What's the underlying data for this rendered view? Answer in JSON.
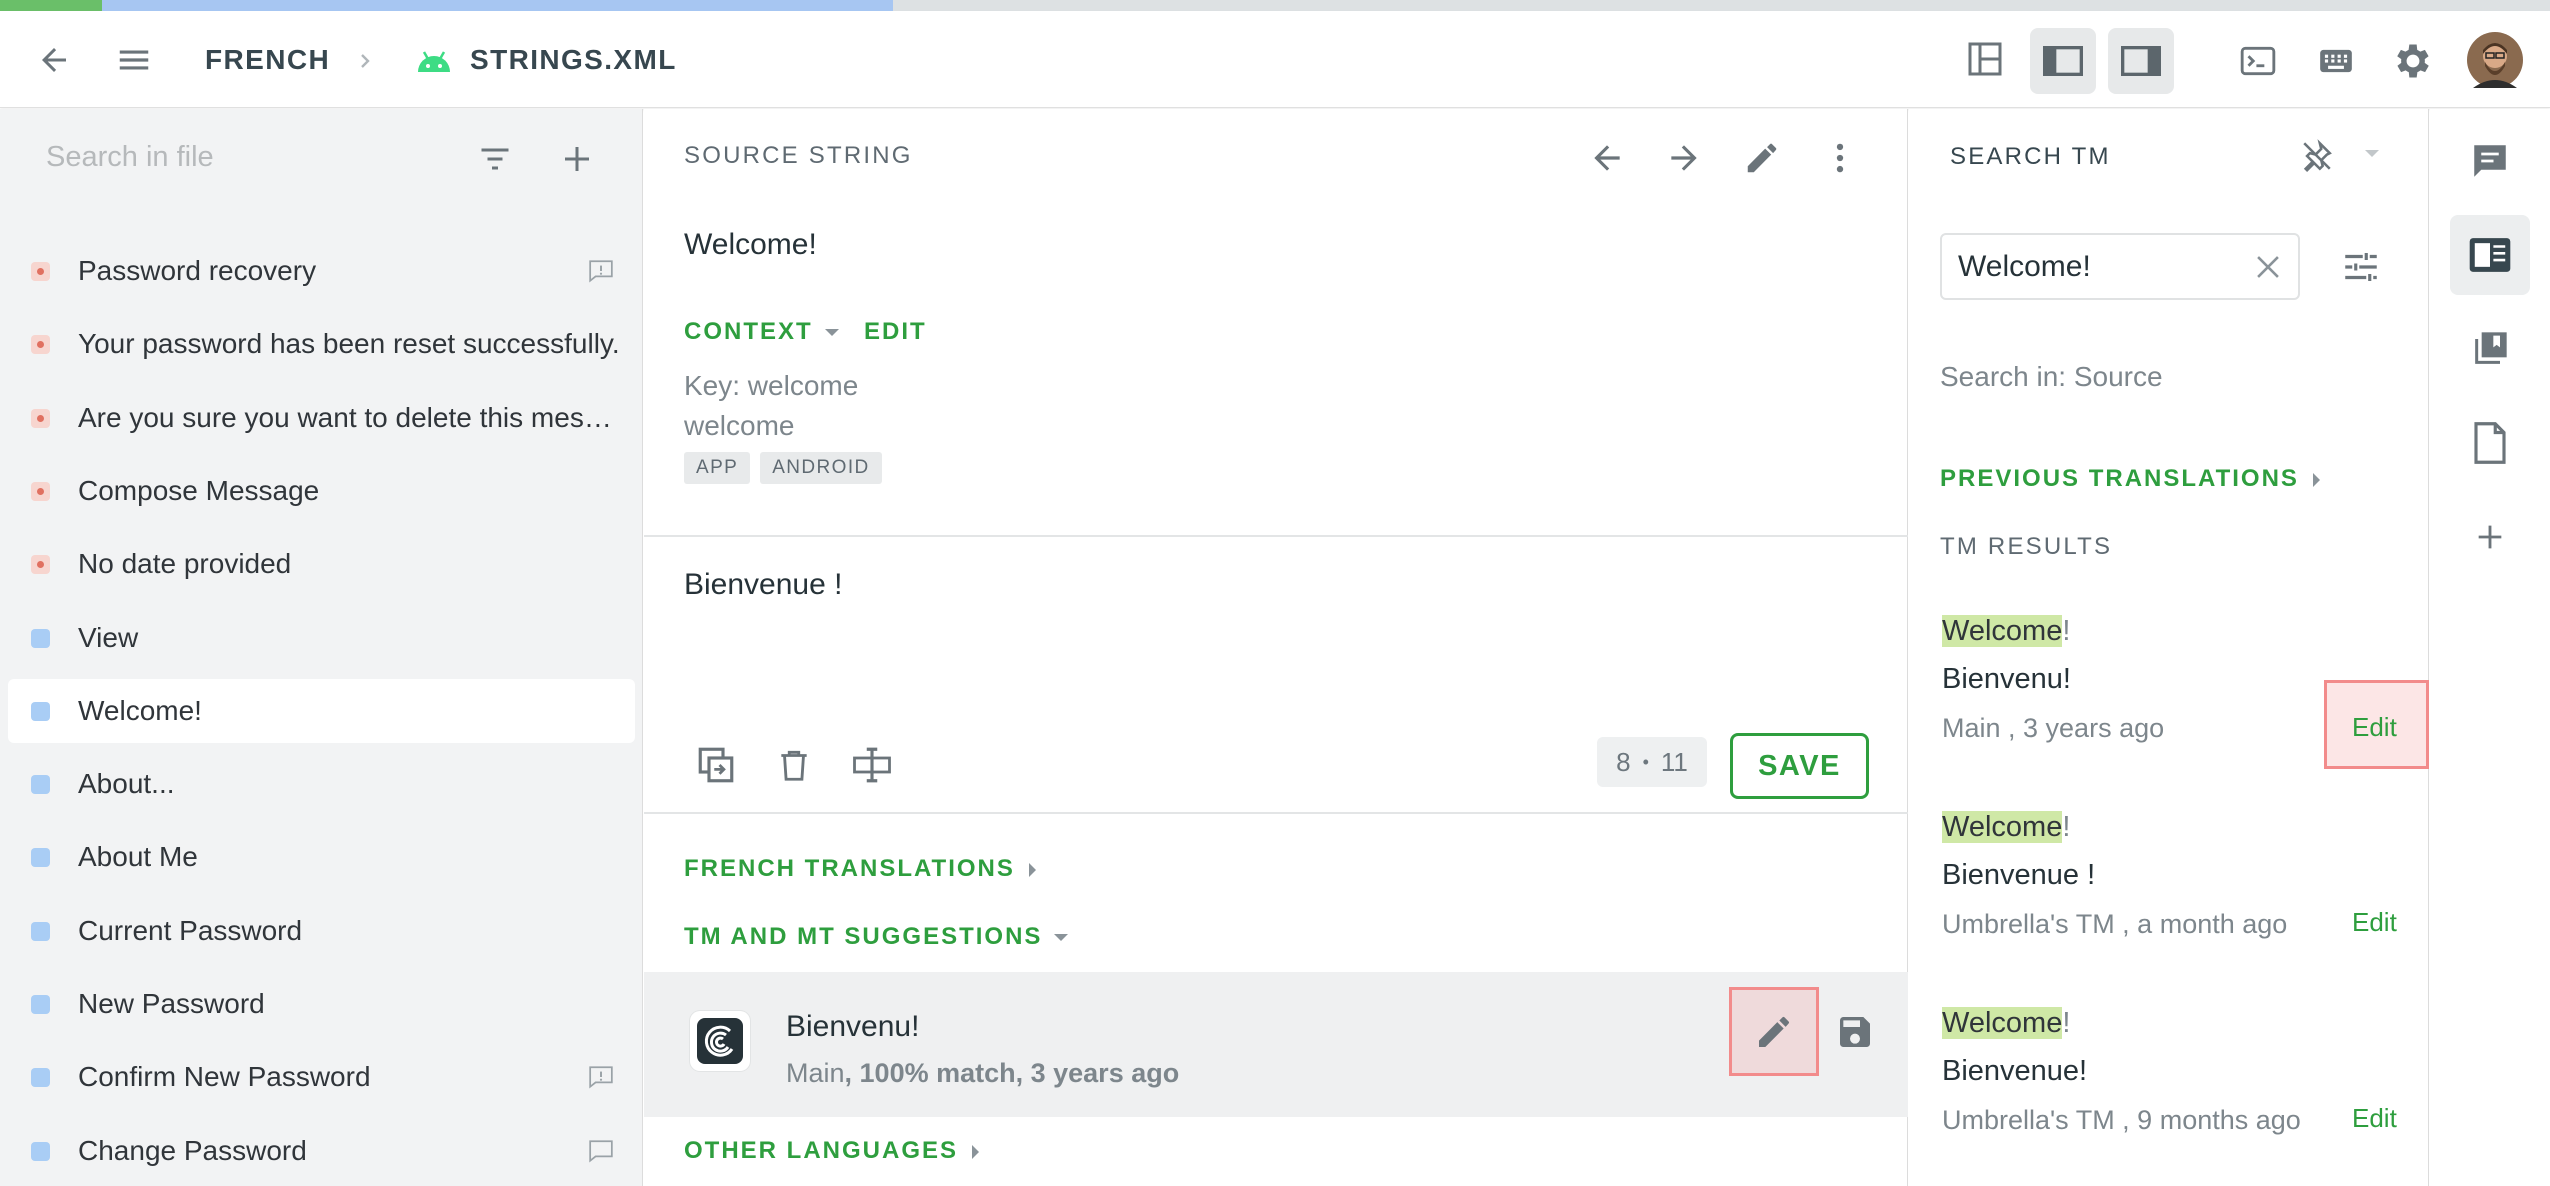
{
  "progress": {
    "approved_fraction": 0.04,
    "translated_fraction": 0.31,
    "colors": {
      "approved": "#6abf69",
      "translated": "#a7c6f2",
      "remaining": "#dde1e3"
    }
  },
  "header": {
    "back_icon": "arrow-left-icon",
    "menu_icon": "hamburger-icon",
    "breadcrumb_language": "FRENCH",
    "breadcrumb_separator_icon": "chevron-right-icon",
    "file_icon": "android-icon",
    "breadcrumb_file": "STRINGS.XML",
    "layout_icons": [
      "layout-grid-icon",
      "layout-left-sidebar-icon",
      "layout-right-sidebar-icon"
    ],
    "tool_icons": [
      "terminal-icon",
      "keyboard-icon",
      "gear-icon"
    ],
    "avatar_icon": "user-avatar"
  },
  "sidebar": {
    "search_placeholder": "Search in file",
    "filter_icon": "filter-icon",
    "add_icon": "plus-icon",
    "items": [
      {
        "label": "Password recovery",
        "status": "untranslated",
        "comment_icon": "comment-alert-icon"
      },
      {
        "label": "Your password has been reset successfully.",
        "status": "untranslated",
        "comment_icon": ""
      },
      {
        "label": "Are you sure you want to delete this message?",
        "status": "untranslated",
        "comment_icon": ""
      },
      {
        "label": "Compose Message",
        "status": "untranslated",
        "comment_icon": ""
      },
      {
        "label": "No date provided",
        "status": "untranslated",
        "comment_icon": ""
      },
      {
        "label": "View",
        "status": "translated",
        "comment_icon": ""
      },
      {
        "label": "Welcome!",
        "status": "translated",
        "comment_icon": "",
        "active": true
      },
      {
        "label": "About...",
        "status": "translated",
        "comment_icon": ""
      },
      {
        "label": "About Me",
        "status": "translated",
        "comment_icon": ""
      },
      {
        "label": "Current Password",
        "status": "translated",
        "comment_icon": ""
      },
      {
        "label": "New Password",
        "status": "translated",
        "comment_icon": ""
      },
      {
        "label": "Confirm New Password",
        "status": "translated",
        "comment_icon": "comment-alert-icon"
      },
      {
        "label": "Change Password",
        "status": "translated",
        "comment_icon": "comment-icon"
      }
    ]
  },
  "editor": {
    "source_heading": "SOURCE STRING",
    "nav_icons": [
      "arrow-left-icon",
      "arrow-right-icon",
      "pencil-icon",
      "more-vertical-icon"
    ],
    "source_text": "Welcome!",
    "context_label": "CONTEXT",
    "edit_label": "EDIT",
    "context_key": "Key: welcome",
    "context_value": "welcome",
    "tags": [
      "APP",
      "ANDROID"
    ],
    "translation_text": "Bienvenue !",
    "toolbar_icons": [
      "copy-source-icon",
      "delete-icon",
      "text-cursor-icon"
    ],
    "counter_source": "8",
    "counter_separator": "•",
    "counter_translation": "11",
    "save_label": "SAVE",
    "french_translations_label": "FRENCH TRANSLATIONS",
    "tm_mt_label": "TM AND MT SUGGESTIONS",
    "suggestion": {
      "text": "Bienvenu!",
      "meta_source": "Main",
      "meta_rest": ", 100% match, 3 years ago",
      "logo_icon": "crowdin-logo-icon",
      "edit_icon": "pencil-icon",
      "save_icon": "floppy-disk-icon"
    },
    "other_languages_label": "OTHER LANGUAGES"
  },
  "tm_panel": {
    "title": "SEARCH TM",
    "pin_icon": "pin-off-icon",
    "dropdown_icon": "caret-down-icon",
    "search_value": "Welcome!",
    "clear_icon": "close-icon",
    "settings_icon": "tune-icon",
    "search_in": "Search in: Source",
    "previous_translations_label": "PREVIOUS TRANSLATIONS",
    "tm_results_label": "TM RESULTS",
    "results": [
      {
        "match": "Welcome",
        "rest": "!",
        "translation": "Bienvenu!",
        "meta": "Main , 3 years ago",
        "edit_label": "Edit"
      },
      {
        "match": "Welcome",
        "rest": "!",
        "translation": "Bienvenue !",
        "meta": "Umbrella's TM , a month ago",
        "edit_label": "Edit"
      },
      {
        "match": "Welcome",
        "rest": "!",
        "translation": "Bienvenue!",
        "meta": "Umbrella's TM , 9 months ago",
        "edit_label": "Edit"
      }
    ]
  },
  "rail": {
    "icons": [
      "comments-icon",
      "tm-panel-icon",
      "glossary-icon",
      "file-icon",
      "plus-icon"
    ],
    "active_index": 1
  },
  "colors": {
    "accent_green": "#2e9e3e",
    "untranslated": "#e07060",
    "translated": "#a9cdf5",
    "highlight": "#cfe8a6",
    "annotation_red": "#f28b8b"
  }
}
